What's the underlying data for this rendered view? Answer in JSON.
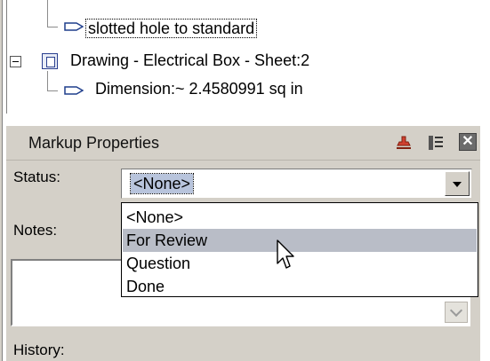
{
  "tree": {
    "items": [
      {
        "label": "slotted hole to standard"
      },
      {
        "label": "Drawing - Electrical Box - Sheet:2"
      },
      {
        "label": "Dimension:~ 2.4580991 sq in"
      }
    ]
  },
  "panel": {
    "title": "Markup Properties",
    "close_glyph": "✕"
  },
  "status": {
    "label": "Status:",
    "selected_value": "<None>"
  },
  "dropdown": {
    "options": [
      "<None>",
      "For Review",
      "Question",
      "Done"
    ],
    "highlighted": "For Review"
  },
  "notes": {
    "label": "Notes:"
  },
  "history": {
    "label": "History:"
  },
  "colors": {
    "panel_bg": "#d4d0c8",
    "highlight": "#b9bdc7"
  },
  "icons": [
    "arrow-icon",
    "drawing-icon",
    "collapse-icon",
    "stamp-icon",
    "list-icon",
    "close-icon",
    "dropdown-arrow-icon",
    "mouse-cursor-icon"
  ]
}
